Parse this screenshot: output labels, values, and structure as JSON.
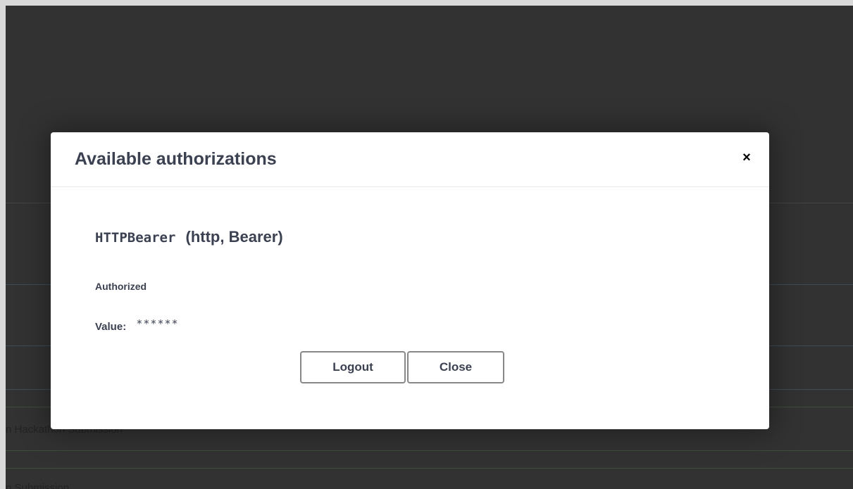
{
  "background": {
    "rows": [
      "n Hackathon Submission",
      "n Submission"
    ]
  },
  "modal": {
    "title": "Available authorizations",
    "close_glyph": "×",
    "scheme": {
      "name": "HTTPBearer",
      "type": "(http, Bearer)",
      "status": "Authorized",
      "value_label": "Value:",
      "value": "******"
    },
    "buttons": {
      "logout": "Logout",
      "close": "Close"
    }
  },
  "colors": {
    "overlay": "#3b3b3b",
    "text": "#3b4151",
    "modal_bg": "#ffffff"
  },
  "icons": {
    "close": "close-icon"
  }
}
